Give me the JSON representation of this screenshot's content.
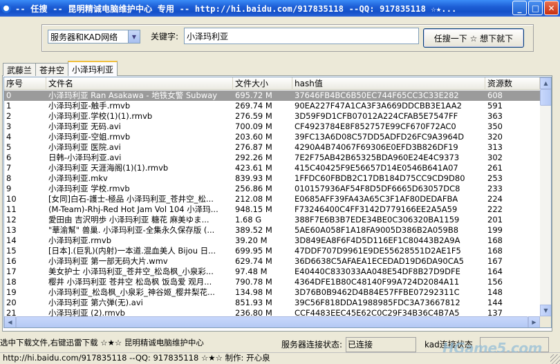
{
  "window": {
    "title": "-- 任搜 -- 昆明精诚电脑维护中心 专用 -- http://hi.baidu.com/917835118 --QQ: 917835118 ☆★...",
    "buttons": {
      "minimize": "_",
      "maximize": "□",
      "close": "✕"
    }
  },
  "search": {
    "mode_selected": "服务器和KAD网络",
    "keyword_label": "关键字:",
    "keyword_value": "小泽玛利亚",
    "button_label": "任搜一下 ☆ 想下就下"
  },
  "tabs": [
    {
      "label": "武藤兰",
      "active": false
    },
    {
      "label": "苍井空",
      "active": false
    },
    {
      "label": "小泽玛利亚",
      "active": true
    }
  ],
  "table": {
    "columns": [
      "序号",
      "文件名",
      "文件大小",
      "hash值",
      "资源数"
    ],
    "selected_index": 0,
    "rows": [
      [
        "0",
        "小泽玛利亚 Ran Asakawa - 地铁女警 Subway",
        "695.72 M",
        "37646FB4BC6B50EC744F65CC3C33E282",
        "608"
      ],
      [
        "1",
        "小泽玛利亚-触手.rmvb",
        "269.74 M",
        "90EA227F47A1CA3F3A669DDCBB3E1AA2",
        "591"
      ],
      [
        "2",
        "小泽玛利亚.学校(1)(1).rmvb",
        "276.59 M",
        "3D59F9D1CFB07012A224CFAB5E7547FF",
        "363"
      ],
      [
        "3",
        "小泽玛利亚 无码.avi",
        "700.09 M",
        "CF4923784E8F852757E99CF670F72AC0",
        "350"
      ],
      [
        "4",
        "小泽玛利亚-空姐.rmvb",
        "203.60 M",
        "39FC13A6D08C57DD5ADFD26FC9A3964D",
        "320"
      ],
      [
        "5",
        "小泽玛利亚 医院.avi",
        "276.87 M",
        "4290A4B74067F69306E0EFD3B826DF19",
        "313"
      ],
      [
        "6",
        "日韩-小泽玛利亚.avi",
        "292.26 M",
        "7E2F75AB42B65325BDA960E24E4C9373",
        "302"
      ],
      [
        "7",
        "小泽玛利亚 天涯海阁(1)(1).rmvb",
        "423.61 M",
        "415C40425F9E56657D14E0546B641A07",
        "261"
      ],
      [
        "8",
        "小泽玛利亚.mkv",
        "839.93 M",
        "1FFDC60FBDB2C17DB184D75CC9CD9D80",
        "253"
      ],
      [
        "9",
        "小泽玛利亚 学校.rmvb",
        "256.86 M",
        "010157936AF54F8D5DF6665D63057DC8",
        "233"
      ],
      [
        "10",
        "[女同]白石-護士-極品 小泽玛利亚_苍井空_松...",
        "212.08 M",
        "E0685AFF39FA43A65C3F1AF80DEDAFBA",
        "224"
      ],
      [
        "11",
        "(M-Team)-Rhj-Red Hot Jam Vol 104 小泽玛...",
        "948.15 M",
        "F73246400C4FF3142D779166EE2A5A59",
        "222"
      ],
      [
        "12",
        "愛田由 吉沢明歩 小泽玛利亚 糖花 麻美ゆま...",
        "1.68 G",
        "388F7E6B3B7EDE34BE0C306320BA1159",
        "201"
      ],
      [
        "13",
        "\"華渝幫\" 兽巢. 小泽玛利亚-全集永久保存版 (...",
        "389.52 M",
        "5AE60A058F1A18FA9005D386B2A059B8",
        "199"
      ],
      [
        "14",
        "小泽玛利亚.rmvb",
        "39.20 M",
        "3D849EA8F6F4D5D116EF1C80443B2A9A",
        "168"
      ],
      [
        "15",
        "[日本].(巨乳)(内射)一本道.混血美人 Bijou 日...",
        "699.95 M",
        "47DDF707D9961E9DE55628551D2AE1F5",
        "168"
      ],
      [
        "16",
        "小泽玛利亚 第一部无码大片.wmv",
        "629.74 M",
        "36D6638C5AFAEA1ECEDAD19D6DA90CA5",
        "167"
      ],
      [
        "17",
        "美女护士 小泽玛利亚_苍井空_松岛枫_小泉彩...",
        "97.48 M",
        "E40440C833033AA048E54DF8B27D9DFE",
        "164"
      ],
      [
        "18",
        "樱井 小泽玛利亚 苍井空 松岛枫 饭岛爱 观月...",
        "790.78 M",
        "4364DFE1B80C48140F99A724D2084A11",
        "156"
      ],
      [
        "19",
        "小泽玛利亚_松岛枫_小泉彩_神谷姬_樱井梨花...",
        "134.98 M",
        "3D76B0B9462D4B84E57FFBE07292311C",
        "148"
      ],
      [
        "20",
        "小泽玛利亚 第六弹(无).avi",
        "851.93 M",
        "39C56F818DDA1988985FDC3A73667812",
        "144"
      ],
      [
        "21",
        "小泽玛利亚 (2).rmvb",
        "236.80 M",
        "CCF4483EEC45E62C0C29F34B36C4B7A5",
        "137"
      ]
    ]
  },
  "status": {
    "tip": "选中下载文件,右键迅雷下载 ☆★☆ 昆明精诚电脑维护中心",
    "server_label": "服务器连接状态:",
    "server_status": "已连接",
    "kad_label": "kad连接状态",
    "footer": "http://hi.baidu.com/917835118 --QQ: 917835118 ☆★☆ 制作: 开心泉",
    "watermark": "HGame5.com"
  }
}
